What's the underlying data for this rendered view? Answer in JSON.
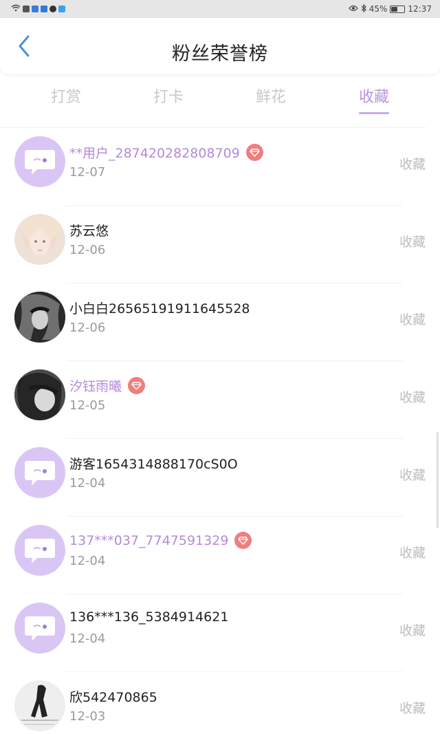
{
  "status_bar": {
    "battery": "45%",
    "time": "12:37"
  },
  "header": {
    "title": "粉丝荣誉榜"
  },
  "tabs": [
    {
      "label": "打赏"
    },
    {
      "label": "打卡"
    },
    {
      "label": "鲜花"
    },
    {
      "label": "收藏"
    }
  ],
  "active_tab": "收藏",
  "colors": {
    "accent": "#b795dc",
    "vip_badge": "#ee7f7f",
    "default_avatar": "#d9c6f5"
  },
  "list": [
    {
      "name": "**用户_287420282808709",
      "date": "12-07",
      "action": "收藏",
      "vip": true,
      "avatar": "default"
    },
    {
      "name": "苏云悠",
      "date": "12-06",
      "action": "收藏",
      "vip": false,
      "avatar": "photo"
    },
    {
      "name": "小白白26565191911645528",
      "date": "12-06",
      "action": "收藏",
      "vip": false,
      "avatar": "photo"
    },
    {
      "name": "汐钰雨曦",
      "date": "12-05",
      "action": "收藏",
      "vip": true,
      "avatar": "photo"
    },
    {
      "name": "游客1654314888170cS0O",
      "date": "12-04",
      "action": "收藏",
      "vip": false,
      "avatar": "default"
    },
    {
      "name": "137***037_7747591329",
      "date": "12-04",
      "action": "收藏",
      "vip": true,
      "avatar": "default"
    },
    {
      "name": "136***136_5384914621",
      "date": "12-04",
      "action": "收藏",
      "vip": false,
      "avatar": "default"
    },
    {
      "name": "欣542470865",
      "date": "12-03",
      "action": "收藏",
      "vip": false,
      "avatar": "photo"
    }
  ]
}
